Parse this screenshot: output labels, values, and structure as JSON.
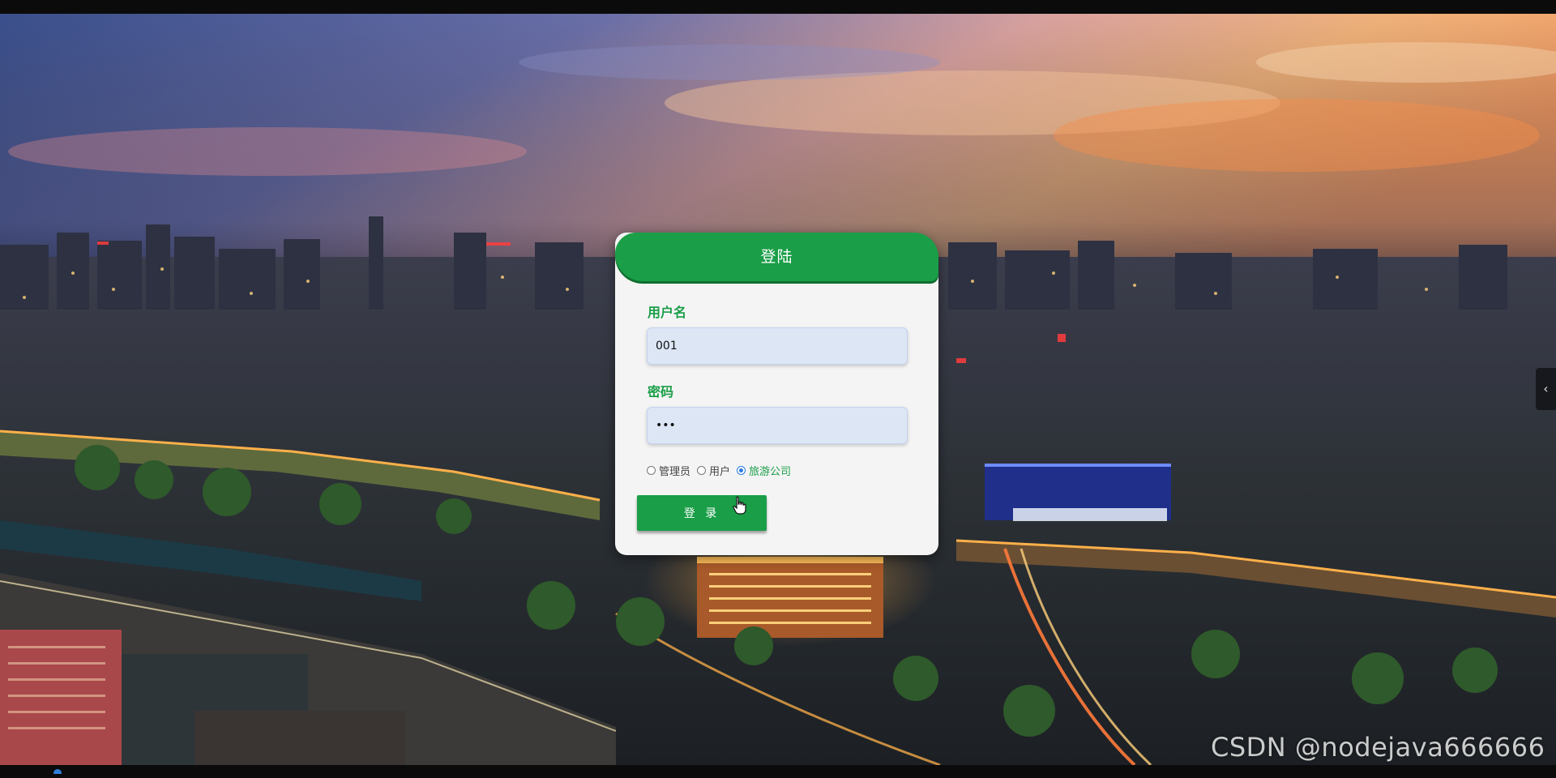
{
  "login": {
    "title": "登陆",
    "username_label": "用户名",
    "username_value": "001",
    "password_label": "密码",
    "password_value": "•••",
    "roles": [
      {
        "label": "管理员",
        "selected": false
      },
      {
        "label": "用户",
        "selected": false
      },
      {
        "label": "旅游公司",
        "selected": true
      }
    ],
    "submit_label": "登 录"
  },
  "watermark": "CSDN @nodejava666666",
  "side_toggle": "‹",
  "colors": {
    "accent": "#1a9e48",
    "card_bg": "#f4f4f4",
    "input_bg": "#dce6f5",
    "radio_checked": "#2a7be0"
  }
}
